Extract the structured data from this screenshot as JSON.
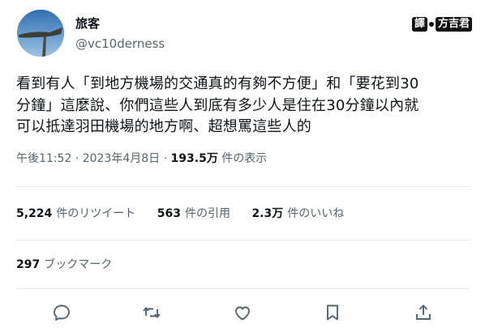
{
  "user": {
    "display_name": "旅客",
    "handle": "@vc10derness"
  },
  "watermark": {
    "left": "譯",
    "right": "方吉君"
  },
  "tweet": {
    "text_lines": [
      "看到有人「到地方機場的交通真的有夠不方便」和「要花到30",
      "分鐘」這麼說、你們這些人到底有多少人是住在30分鐘以內就",
      "可以抵達羽田機場的地方啊、超想罵這些人的"
    ]
  },
  "meta": {
    "time": "午後11:52",
    "sep1": "·",
    "date": "2023年4月8日",
    "sep2": "·",
    "views": "193.5万",
    "views_label": "件の表示"
  },
  "stats": {
    "retweets_count": "5,224",
    "retweets_label": "件のリツイート",
    "quotes_count": "563",
    "quotes_label": "件の引用",
    "likes_count": "2.3万",
    "likes_label": "件のいいね",
    "bookmarks_count": "297",
    "bookmarks_label": "ブックマーク"
  },
  "actions": [
    {
      "icon": "reply-icon"
    },
    {
      "icon": "retweet-icon"
    },
    {
      "icon": "like-icon"
    },
    {
      "icon": "bookmark-icon"
    },
    {
      "icon": "share-icon"
    }
  ],
  "colors": {
    "text": "#0f1419",
    "secondary": "#536471",
    "divider": "#e6ecf0",
    "icon": "#536471"
  }
}
